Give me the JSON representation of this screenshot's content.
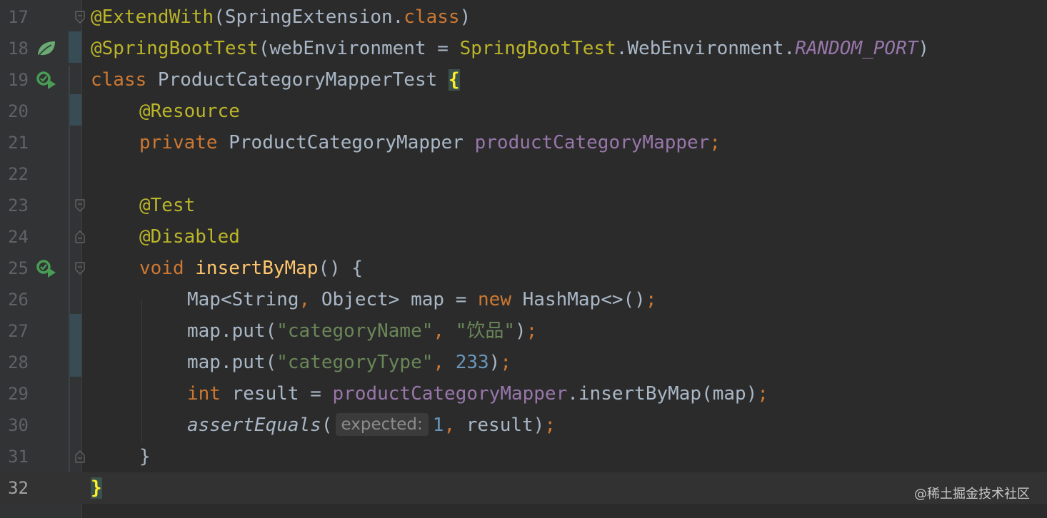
{
  "editor": {
    "line_numbers": [
      "17",
      "18",
      "19",
      "20",
      "21",
      "22",
      "23",
      "24",
      "25",
      "26",
      "27",
      "28",
      "29",
      "30",
      "31",
      "32"
    ],
    "current_line": "32",
    "tokens": {
      "l17_a": "@ExtendWith",
      "l17_b": "(SpringExtension.",
      "l17_c": "class",
      "l17_d": ")",
      "l18_a": "@SpringBootTest",
      "l18_b": "(webEnvironment = ",
      "l18_c": "SpringBootTest",
      "l18_d": ".WebEnvironment.",
      "l18_e": "RANDOM_PORT",
      "l18_f": ")",
      "l19_a": "class ",
      "l19_b": "ProductCategoryMapperTest ",
      "l19_c": "{",
      "l20_a": "@Resource",
      "l21_a": "private ",
      "l21_b": "ProductCategoryMapper ",
      "l21_c": "productCategoryMapper",
      "l21_d": ";",
      "l23_a": "@Test",
      "l24_a": "@Disabled",
      "l25_a": "void ",
      "l25_b": "insertByMap",
      "l25_c": "() {",
      "l26_a": "Map<String",
      "l26_b": ", ",
      "l26_c": "Object> map = ",
      "l26_d": "new ",
      "l26_e": "HashMap<>()",
      "l26_f": ";",
      "l27_a": "map.put(",
      "l27_b": "\"categoryName\"",
      "l27_c": ", ",
      "l27_d": "\"饮品\"",
      "l27_e": ")",
      "l27_f": ";",
      "l28_a": "map.put(",
      "l28_b": "\"categoryType\"",
      "l28_c": ", ",
      "l28_d": "233",
      "l28_e": ")",
      "l28_f": ";",
      "l29_a": "int ",
      "l29_b": "result = ",
      "l29_c": "productCategoryMapper",
      "l29_d": ".insertByMap(map)",
      "l29_e": ";",
      "l30_a": "assertEquals",
      "l30_b": "(",
      "l30_hint": "expected:",
      "l30_c": "1",
      "l30_d": ", ",
      "l30_e": "result)",
      "l30_f": ";",
      "l31_a": "}",
      "l32_a": "}"
    },
    "icons": {
      "spring_bean": "spring-leaf-icon",
      "run_test": "run-test-icon",
      "fold": "fold-marker-icon"
    }
  },
  "watermark": "@稀土掘金技术社区",
  "colors": {
    "background": "#2b2b2b",
    "keyword": "#cc7832",
    "annotation": "#bbb529",
    "string": "#6a8759",
    "number": "#6897bb",
    "field": "#9876aa",
    "method": "#ffc66d",
    "text": "#a9b7c6"
  }
}
